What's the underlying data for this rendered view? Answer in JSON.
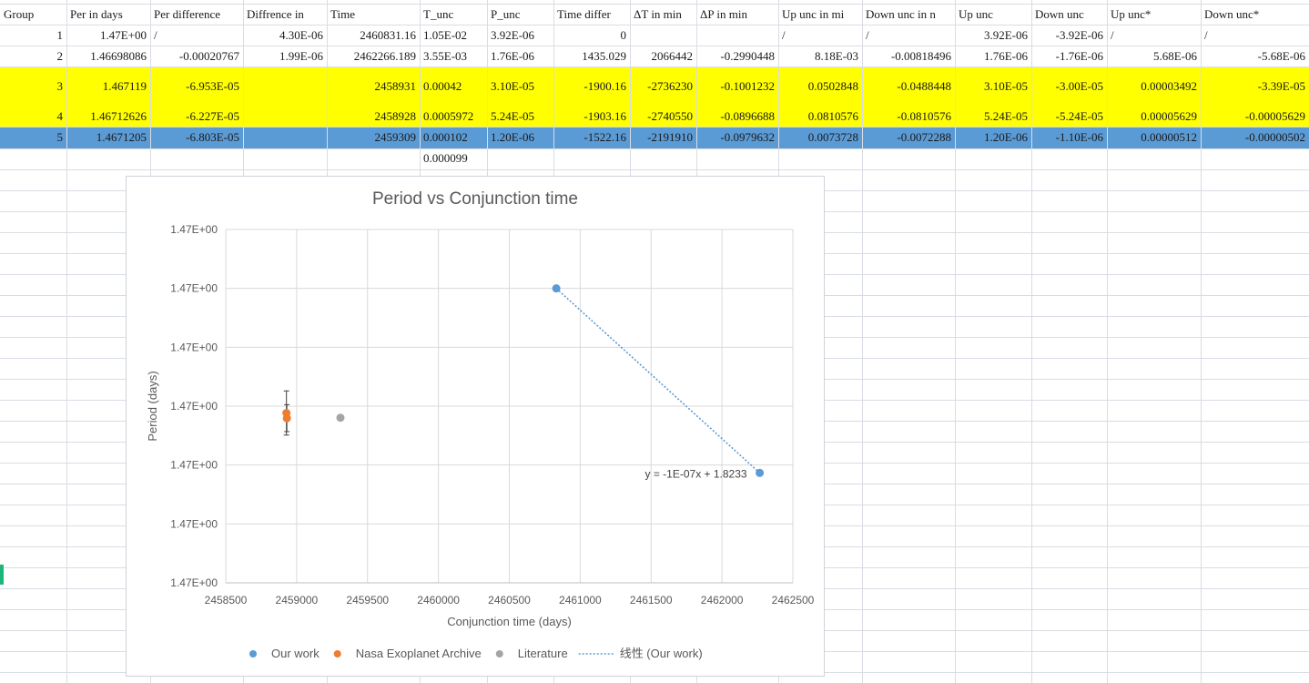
{
  "sheet": {
    "headers": [
      "Group",
      "Per in days",
      "Per difference",
      "Diffrence in",
      "Time",
      "T_unc",
      "P_unc",
      "Time differ",
      "ΔT in min",
      "ΔP in min",
      "Up unc in mi",
      "Down unc in n",
      "Up unc",
      "Down unc",
      "Up unc*",
      "Down unc*"
    ],
    "rows": [
      [
        "1",
        "1.47E+00",
        "/",
        "4.30E-06",
        "2460831.16",
        "1.05E-02",
        "3.92E-06",
        "0",
        "",
        "",
        "/",
        "/",
        "3.92E-06",
        "-3.92E-06",
        "/",
        "/"
      ],
      [
        "2",
        "1.46698086",
        "-0.00020767",
        "1.99E-06",
        "2462266.189",
        "3.55E-03",
        "1.76E-06",
        "1435.029",
        "2066442",
        "-0.2990448",
        "8.18E-03",
        "-0.00818496",
        "1.76E-06",
        "-1.76E-06",
        "5.68E-06",
        "-5.68E-06"
      ],
      [
        "3",
        "1.467119",
        "-6.953E-05",
        "",
        "2458931",
        "0.00042",
        "3.10E-05",
        "-1900.16",
        "-2736230",
        "-0.1001232",
        "0.0502848",
        "-0.0488448",
        "3.10E-05",
        "-3.00E-05",
        "0.00003492",
        "-3.39E-05"
      ],
      [
        "4",
        "1.46712626",
        "-6.227E-05",
        "",
        "2458928",
        "0.0005972",
        "5.24E-05",
        "-1903.16",
        "-2740550",
        "-0.0896688",
        "0.0810576",
        "-0.0810576",
        "5.24E-05",
        "-5.24E-05",
        "0.00005629",
        "-0.00005629"
      ],
      [
        "5",
        "1.4671205",
        "-6.803E-05",
        "",
        "2459309",
        "0.000102",
        "1.20E-06",
        "-1522.16",
        "-2191910",
        "-0.0979632",
        "0.0073728",
        "-0.0072288",
        "1.20E-06",
        "-1.10E-06",
        "0.00000512",
        "-0.00000502"
      ],
      [
        "",
        "",
        "",
        "",
        "",
        "0.000099",
        "",
        "",
        "",
        "",
        "",
        "",
        "",
        "",
        "",
        ""
      ]
    ],
    "colors": {
      "highlight_yellow": "#ffff00",
      "selection_blue": "#5b9bd5",
      "grid": "#d9dce3"
    }
  },
  "chart_data": {
    "type": "scatter",
    "title": "Period vs Conjunction time",
    "xlabel": "Conjunction time (days)",
    "ylabel": "Period (days)",
    "xlim": [
      2458500,
      2462500
    ],
    "ylim": [
      1.4667,
      1.4676
    ],
    "x_ticks": [
      "2458500",
      "2459000",
      "2459500",
      "2460000",
      "2460500",
      "2461000",
      "2461500",
      "2462000",
      "2462500"
    ],
    "y_ticks": [
      "1.47E+00",
      "1.47E+00",
      "1.47E+00",
      "1.47E+00",
      "1.47E+00",
      "1.47E+00",
      "1.47E+00"
    ],
    "grid": true,
    "legend_position": "bottom",
    "series": [
      {
        "name": "Our work",
        "color": "#5b9bd5",
        "points": [
          {
            "x": 2460831.16,
            "y": 1.46745,
            "err": 3.9e-06
          },
          {
            "x": 2462266.189,
            "y": 1.46698,
            "err": 1.8e-06
          }
        ]
      },
      {
        "name": "Nasa Exoplanet Archive",
        "color": "#ed7d31",
        "points": [
          {
            "x": 2458931,
            "y": 1.467119,
            "err_up": 3.49e-05,
            "err_down": 3.39e-05
          },
          {
            "x": 2458928,
            "y": 1.4671326,
            "err_up": 5.63e-05,
            "err_down": 5.63e-05
          }
        ]
      },
      {
        "name": "Literature",
        "color": "#a5a5a5",
        "points": [
          {
            "x": 2459309,
            "y": 1.4671205,
            "err_up": 5.1e-06,
            "err_down": 5e-06
          }
        ]
      }
    ],
    "trendline": {
      "name": "线性 (Our work)",
      "color": "#5b9bd5",
      "equation": "y = -1E-07x + 1.8233",
      "from_x": 2460831.16,
      "to_x": 2462266.189
    }
  }
}
